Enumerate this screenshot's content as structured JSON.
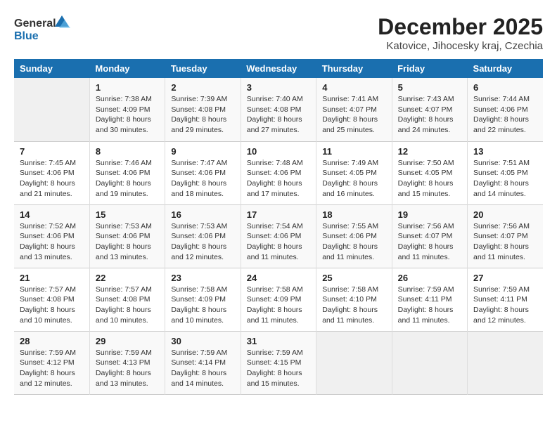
{
  "logo": {
    "text_general": "General",
    "text_blue": "Blue"
  },
  "title": "December 2025",
  "subtitle": "Katovice, Jihocesky kraj, Czechia",
  "days_of_week": [
    "Sunday",
    "Monday",
    "Tuesday",
    "Wednesday",
    "Thursday",
    "Friday",
    "Saturday"
  ],
  "weeks": [
    [
      {
        "day": "",
        "info": ""
      },
      {
        "day": "1",
        "info": "Sunrise: 7:38 AM\nSunset: 4:09 PM\nDaylight: 8 hours\nand 30 minutes."
      },
      {
        "day": "2",
        "info": "Sunrise: 7:39 AM\nSunset: 4:08 PM\nDaylight: 8 hours\nand 29 minutes."
      },
      {
        "day": "3",
        "info": "Sunrise: 7:40 AM\nSunset: 4:08 PM\nDaylight: 8 hours\nand 27 minutes."
      },
      {
        "day": "4",
        "info": "Sunrise: 7:41 AM\nSunset: 4:07 PM\nDaylight: 8 hours\nand 25 minutes."
      },
      {
        "day": "5",
        "info": "Sunrise: 7:43 AM\nSunset: 4:07 PM\nDaylight: 8 hours\nand 24 minutes."
      },
      {
        "day": "6",
        "info": "Sunrise: 7:44 AM\nSunset: 4:06 PM\nDaylight: 8 hours\nand 22 minutes."
      }
    ],
    [
      {
        "day": "7",
        "info": "Sunrise: 7:45 AM\nSunset: 4:06 PM\nDaylight: 8 hours\nand 21 minutes."
      },
      {
        "day": "8",
        "info": "Sunrise: 7:46 AM\nSunset: 4:06 PM\nDaylight: 8 hours\nand 19 minutes."
      },
      {
        "day": "9",
        "info": "Sunrise: 7:47 AM\nSunset: 4:06 PM\nDaylight: 8 hours\nand 18 minutes."
      },
      {
        "day": "10",
        "info": "Sunrise: 7:48 AM\nSunset: 4:06 PM\nDaylight: 8 hours\nand 17 minutes."
      },
      {
        "day": "11",
        "info": "Sunrise: 7:49 AM\nSunset: 4:05 PM\nDaylight: 8 hours\nand 16 minutes."
      },
      {
        "day": "12",
        "info": "Sunrise: 7:50 AM\nSunset: 4:05 PM\nDaylight: 8 hours\nand 15 minutes."
      },
      {
        "day": "13",
        "info": "Sunrise: 7:51 AM\nSunset: 4:05 PM\nDaylight: 8 hours\nand 14 minutes."
      }
    ],
    [
      {
        "day": "14",
        "info": "Sunrise: 7:52 AM\nSunset: 4:06 PM\nDaylight: 8 hours\nand 13 minutes."
      },
      {
        "day": "15",
        "info": "Sunrise: 7:53 AM\nSunset: 4:06 PM\nDaylight: 8 hours\nand 13 minutes."
      },
      {
        "day": "16",
        "info": "Sunrise: 7:53 AM\nSunset: 4:06 PM\nDaylight: 8 hours\nand 12 minutes."
      },
      {
        "day": "17",
        "info": "Sunrise: 7:54 AM\nSunset: 4:06 PM\nDaylight: 8 hours\nand 11 minutes."
      },
      {
        "day": "18",
        "info": "Sunrise: 7:55 AM\nSunset: 4:06 PM\nDaylight: 8 hours\nand 11 minutes."
      },
      {
        "day": "19",
        "info": "Sunrise: 7:56 AM\nSunset: 4:07 PM\nDaylight: 8 hours\nand 11 minutes."
      },
      {
        "day": "20",
        "info": "Sunrise: 7:56 AM\nSunset: 4:07 PM\nDaylight: 8 hours\nand 11 minutes."
      }
    ],
    [
      {
        "day": "21",
        "info": "Sunrise: 7:57 AM\nSunset: 4:08 PM\nDaylight: 8 hours\nand 10 minutes."
      },
      {
        "day": "22",
        "info": "Sunrise: 7:57 AM\nSunset: 4:08 PM\nDaylight: 8 hours\nand 10 minutes."
      },
      {
        "day": "23",
        "info": "Sunrise: 7:58 AM\nSunset: 4:09 PM\nDaylight: 8 hours\nand 10 minutes."
      },
      {
        "day": "24",
        "info": "Sunrise: 7:58 AM\nSunset: 4:09 PM\nDaylight: 8 hours\nand 11 minutes."
      },
      {
        "day": "25",
        "info": "Sunrise: 7:58 AM\nSunset: 4:10 PM\nDaylight: 8 hours\nand 11 minutes."
      },
      {
        "day": "26",
        "info": "Sunrise: 7:59 AM\nSunset: 4:11 PM\nDaylight: 8 hours\nand 11 minutes."
      },
      {
        "day": "27",
        "info": "Sunrise: 7:59 AM\nSunset: 4:11 PM\nDaylight: 8 hours\nand 12 minutes."
      }
    ],
    [
      {
        "day": "28",
        "info": "Sunrise: 7:59 AM\nSunset: 4:12 PM\nDaylight: 8 hours\nand 12 minutes."
      },
      {
        "day": "29",
        "info": "Sunrise: 7:59 AM\nSunset: 4:13 PM\nDaylight: 8 hours\nand 13 minutes."
      },
      {
        "day": "30",
        "info": "Sunrise: 7:59 AM\nSunset: 4:14 PM\nDaylight: 8 hours\nand 14 minutes."
      },
      {
        "day": "31",
        "info": "Sunrise: 7:59 AM\nSunset: 4:15 PM\nDaylight: 8 hours\nand 15 minutes."
      },
      {
        "day": "",
        "info": ""
      },
      {
        "day": "",
        "info": ""
      },
      {
        "day": "",
        "info": ""
      }
    ]
  ]
}
